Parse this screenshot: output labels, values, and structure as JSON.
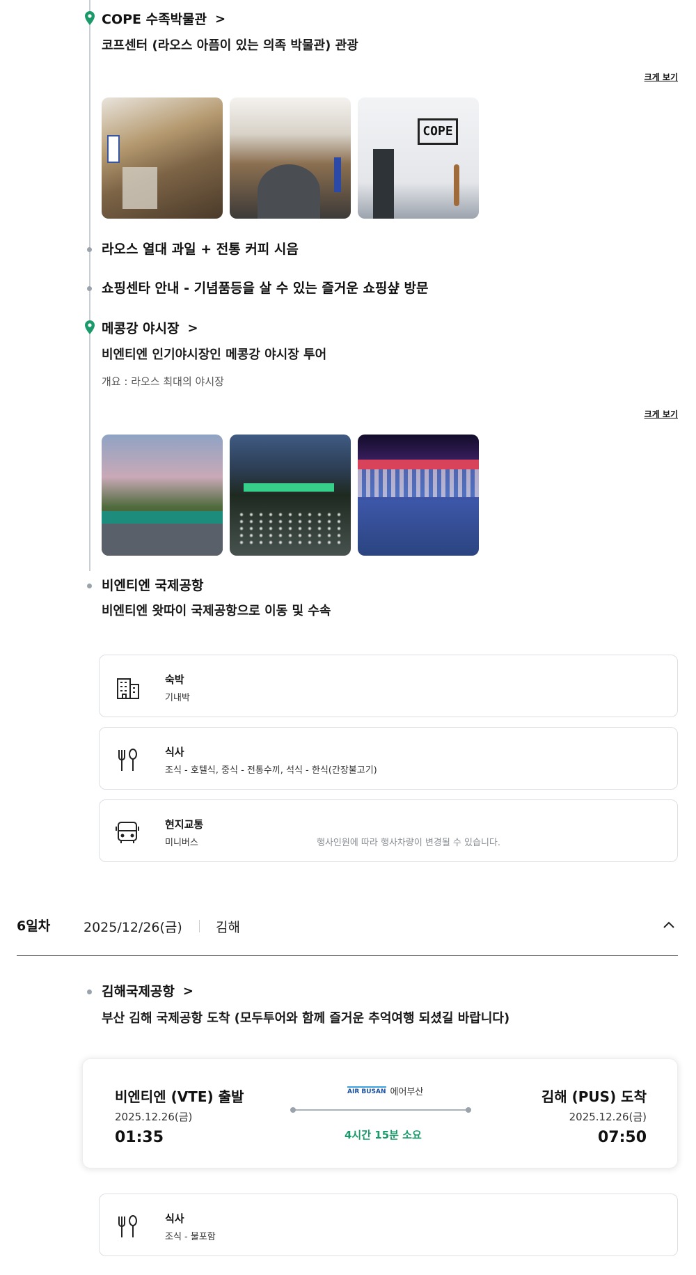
{
  "schedule": [
    {
      "title": "COPE 수족박물관",
      "subtitle": "코프센터 (라오스 아픔이 있는 의족 박물관) 관광",
      "enlarge_label": "크게 보기",
      "photos": [
        "cope-photo-1",
        "cope-photo-2",
        "cope-photo-3"
      ]
    },
    {
      "title": "라오스 열대 과일 + 전통 커피 시음"
    },
    {
      "title": "쇼핑센타 안내 - 기념품등을 살 수 있는 즐거운 쇼핑샾 방문"
    },
    {
      "title": "메콩강 야시장",
      "subtitle": "비엔티엔 인기야시장인 메콩강 야시장 투어",
      "desc": "개요 : 라오스 최대의 야시장",
      "enlarge_label": "크게 보기",
      "photos": [
        "night-market-photo-1",
        "night-market-photo-2",
        "night-market-photo-3"
      ]
    },
    {
      "title": "비엔티엔 국제공항",
      "subtitle": "비엔티엔 왓따이 국제공항으로 이동 및 수속"
    }
  ],
  "info": {
    "lodging": {
      "label": "숙박",
      "value": "기내박",
      "icon": "building-icon"
    },
    "meal": {
      "label": "식사",
      "value": "조식 - 호텔식, 중식 - 전통수끼, 석식 - 한식(간장불고기)",
      "icon": "fork-spoon-icon"
    },
    "transport": {
      "label": "현지교통",
      "value": "미니버스",
      "note": "행사인원에 따라 행사차량이 변경될 수 있습니다.",
      "icon": "bus-icon"
    }
  },
  "day6": {
    "day": "6일차",
    "date": "2025/12/26(금)",
    "city": "김해",
    "toggle_icon": "chevron-up-icon",
    "stop": {
      "title": "김해국제공항",
      "subtitle": "부산 김해 국제공항 도착 (모두투어와 함께 즐거운 추억여행 되셨길 바랍니다)"
    },
    "flight": {
      "dep_city": "비엔티엔 (VTE) 출발",
      "dep_date": "2025.12.26(금)",
      "dep_time": "01:35",
      "airline_logo": "AIR BUSAN",
      "airline": "에어부산",
      "duration": "4시간 15분 소요",
      "arr_city": "김해 (PUS) 도착",
      "arr_date": "2025.12.26(금)",
      "arr_time": "07:50"
    },
    "meal": {
      "label": "식사",
      "value": "조식 - 불포함",
      "icon": "fork-spoon-icon"
    }
  },
  "colors": {
    "accent": "#1a9a6a",
    "pin": "#1a9a6a",
    "line": "#c9ced3"
  }
}
